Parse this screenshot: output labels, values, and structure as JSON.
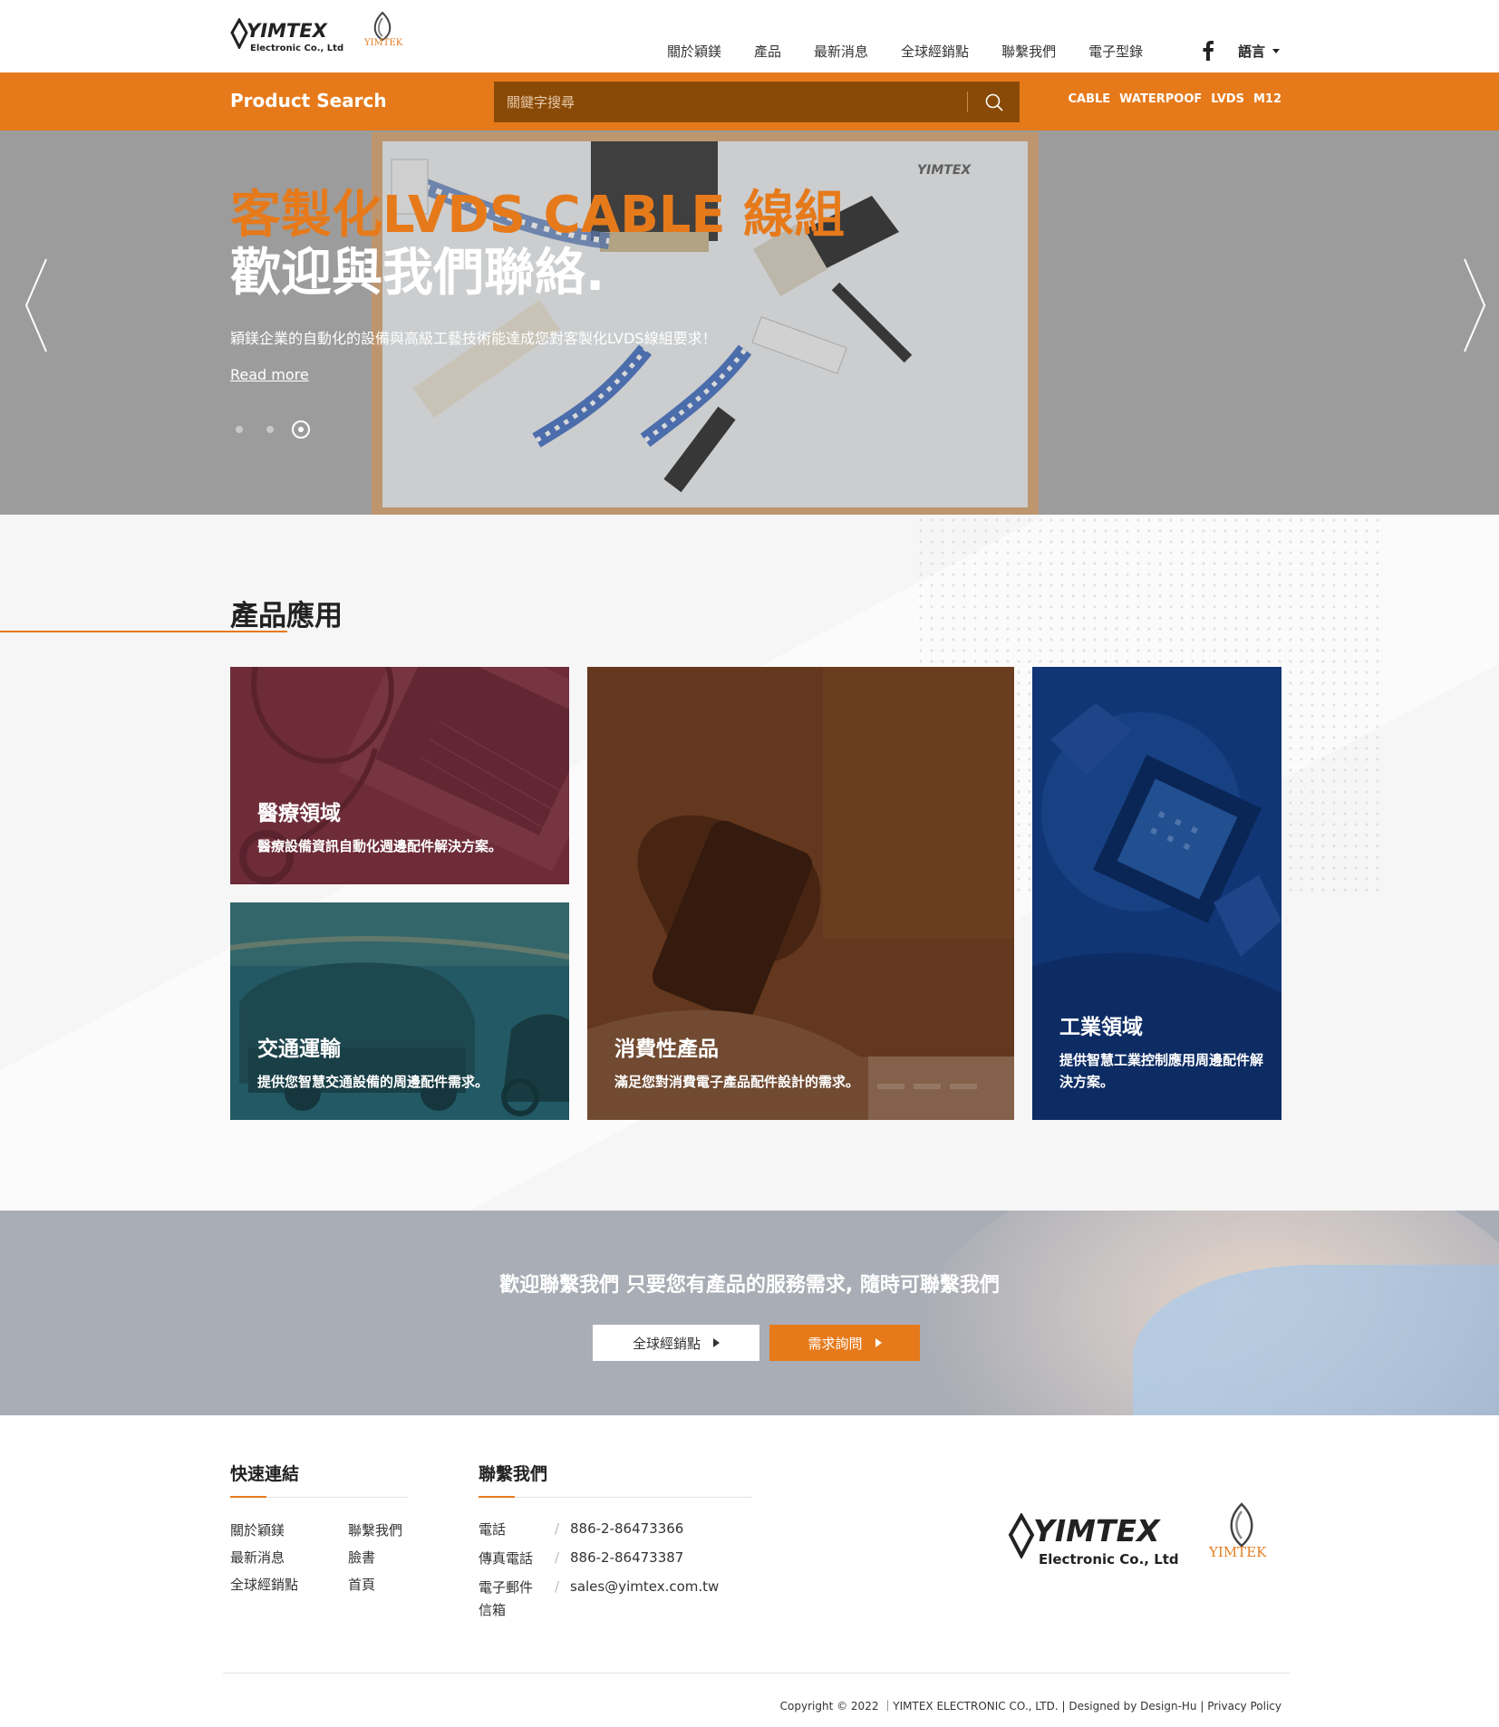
{
  "header": {
    "logo": {
      "brand": "YIMTEX",
      "subtitle": "Electronic Co., Ltd",
      "mark": "YIMTEK"
    },
    "nav": [
      "關於穎鎂",
      "產品",
      "最新消息",
      "全球經銷點",
      "聯繫我們",
      "電子型錄"
    ],
    "facebook_icon": "facebook-icon",
    "language": "語言"
  },
  "search": {
    "title": "Product Search",
    "placeholder": "關鍵字搜尋",
    "tags": [
      "CABLE",
      "WATERPOOF",
      "LVDS",
      "M12"
    ]
  },
  "hero": {
    "title": "客製化LVDS CABLE 線組",
    "subtitle": "歡迎與我們聯絡.",
    "description": "穎鎂企業的自動化的設備與高級工藝技術能達成您對客製化LVDS線組要求！",
    "read_more": "Read more",
    "slides": 3,
    "active_slide": 3
  },
  "applications": {
    "heading": "產品應用",
    "cards": [
      {
        "title": "醫療領域",
        "desc": "醫療設備資訊自動化週邊配件解決方案。"
      },
      {
        "title": "交通運輸",
        "desc": "提供您智慧交通設備的周邊配件需求。"
      },
      {
        "title": "消費性產品",
        "desc": "滿足您對消費電子產品配件設計的需求。"
      },
      {
        "title": "工業領域",
        "desc": "提供智慧工業控制應用周邊配件解決方案。"
      }
    ]
  },
  "banner": {
    "message": "歡迎聯繫我們 只要您有產品的服務需求, 隨時可聯繫我們",
    "button_dealers": "全球經銷點",
    "button_inquiry": "需求詢問"
  },
  "footer": {
    "quick_links_title": "快速連結",
    "quick_links": [
      "關於穎鎂",
      "聯繫我們",
      "最新消息",
      "臉書",
      "全球經銷點",
      "首頁"
    ],
    "contact_title": "聯繫我們",
    "contact": [
      {
        "label": "電話",
        "value": "886-2-86473366"
      },
      {
        "label": "傳真電話",
        "value": "886-2-86473387"
      },
      {
        "label": "電子郵件信箱",
        "value": "sales@yimtex.com.tw"
      }
    ],
    "copyright": "Copyright © 2022 ｜YIMTEX ELECTRONIC CO., LTD. | Designed by Design-Hu | Privacy Policy"
  },
  "colors": {
    "accent": "#e67a1b",
    "search_box": "#8a4a07",
    "medical_overlay": "#6e2d3a",
    "transport_overlay": "#235a64",
    "consumer_overlay": "#5a3018",
    "industrial_overlay": "#0d2f6b"
  }
}
